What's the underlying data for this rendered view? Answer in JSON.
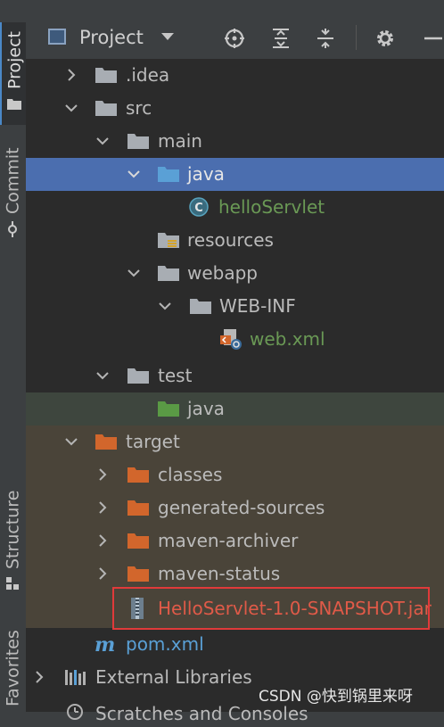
{
  "side_tabs": {
    "project": "Project",
    "commit": "Commit",
    "structure": "Structure",
    "favorites": "Favorites"
  },
  "toolbar": {
    "title": "Project",
    "icons": [
      "locate-icon",
      "expand-all-icon",
      "collapse-all-icon",
      "settings-icon",
      "hide-icon"
    ]
  },
  "tree": [
    {
      "label": ".idea",
      "icon": "folder-icon",
      "expanded": false
    },
    {
      "label": "src",
      "icon": "folder-icon",
      "expanded": true
    },
    {
      "label": "main",
      "icon": "folder-icon",
      "expanded": true
    },
    {
      "label": "java",
      "icon": "source-folder-icon",
      "expanded": true,
      "selected": true
    },
    {
      "label": "helloServlet",
      "icon": "class-icon"
    },
    {
      "label": "resources",
      "icon": "resources-folder-icon"
    },
    {
      "label": "webapp",
      "icon": "folder-icon",
      "expanded": true
    },
    {
      "label": "WEB-INF",
      "icon": "folder-icon",
      "expanded": true
    },
    {
      "label": "web.xml",
      "icon": "xml-file-icon"
    },
    {
      "label": "test",
      "icon": "folder-icon",
      "expanded": true
    },
    {
      "label": "java",
      "icon": "test-folder-icon"
    },
    {
      "label": "target",
      "icon": "excluded-folder-icon",
      "expanded": true
    },
    {
      "label": "classes",
      "icon": "excluded-folder-icon",
      "expanded": false
    },
    {
      "label": "generated-sources",
      "icon": "excluded-folder-icon",
      "expanded": false
    },
    {
      "label": "maven-archiver",
      "icon": "excluded-folder-icon",
      "expanded": false
    },
    {
      "label": "maven-status",
      "icon": "excluded-folder-icon",
      "expanded": false
    },
    {
      "label": "HelloServlet-1.0-SNAPSHOT.jar",
      "icon": "jar-icon"
    },
    {
      "label": "pom.xml",
      "icon": "maven-icon"
    },
    {
      "label": "External Libraries",
      "icon": "libraries-icon",
      "expanded": false
    },
    {
      "label": "Scratches and Consoles",
      "icon": "scratches-icon"
    }
  ],
  "watermark": "CSDN @快到锅里来呀",
  "colors": {
    "selection": "#4b6eaf",
    "test_bg": "#3e463e",
    "excluded_bg": "#4a4439",
    "source_folder": "#5aa0d6",
    "test_folder": "#5a9a45",
    "excluded_folder": "#d2662c",
    "plain_folder": "#a8adb3",
    "green_text": "#6a9955",
    "red_text": "#e05a48",
    "highlight_box": "#e03a3a"
  }
}
